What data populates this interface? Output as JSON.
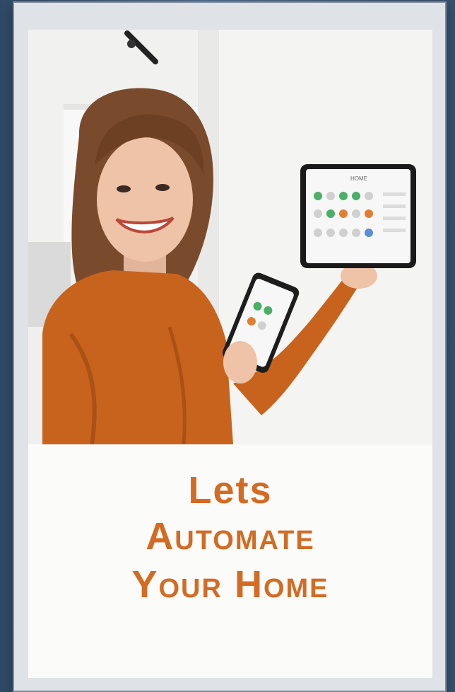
{
  "poster": {
    "headline": {
      "line1": "Lets",
      "line2": "Automate",
      "line3": "Your Home"
    },
    "panel_screen": {
      "title": "HOME"
    },
    "colors": {
      "accent_orange": "#d36b22",
      "screen_green": "#4caf67",
      "background_frame": "#4f6f91"
    }
  }
}
